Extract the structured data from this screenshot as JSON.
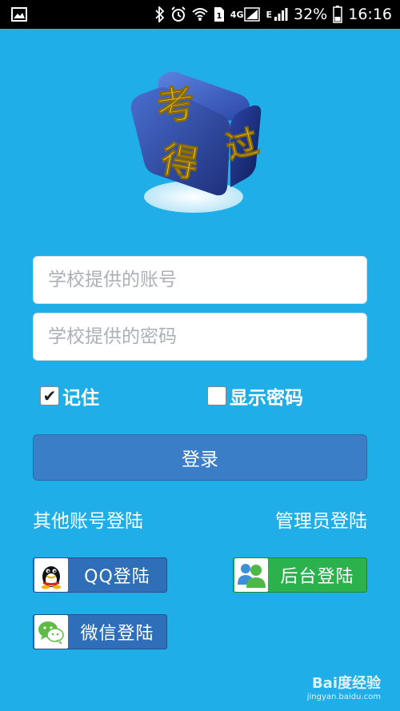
{
  "status_bar": {
    "net_4g": "4G",
    "net_e": "E",
    "battery": "32%",
    "time": "16:16"
  },
  "logo": {
    "char_top": "考",
    "char_bottom": "得",
    "char_side": "过"
  },
  "form": {
    "account_placeholder": "学校提供的账号",
    "password_placeholder": "学校提供的密码",
    "remember_label": "记住",
    "remember_checked": true,
    "show_password_label": "显示密码",
    "show_password_checked": false,
    "login_label": "登录"
  },
  "other_login": {
    "label": "其他账号登陆",
    "admin_label": "管理员登陆",
    "qq_label": "QQ登陆",
    "wechat_label": "微信登陆",
    "backend_label": "后台登陆"
  },
  "watermark": {
    "main": "Bai度经验",
    "sub": "jingyan.baidu.com"
  },
  "colors": {
    "background": "#1FAEE8",
    "login_button": "#3A7EC7",
    "qq_button": "#2F6EB8",
    "backend_button": "#2BB24C"
  }
}
